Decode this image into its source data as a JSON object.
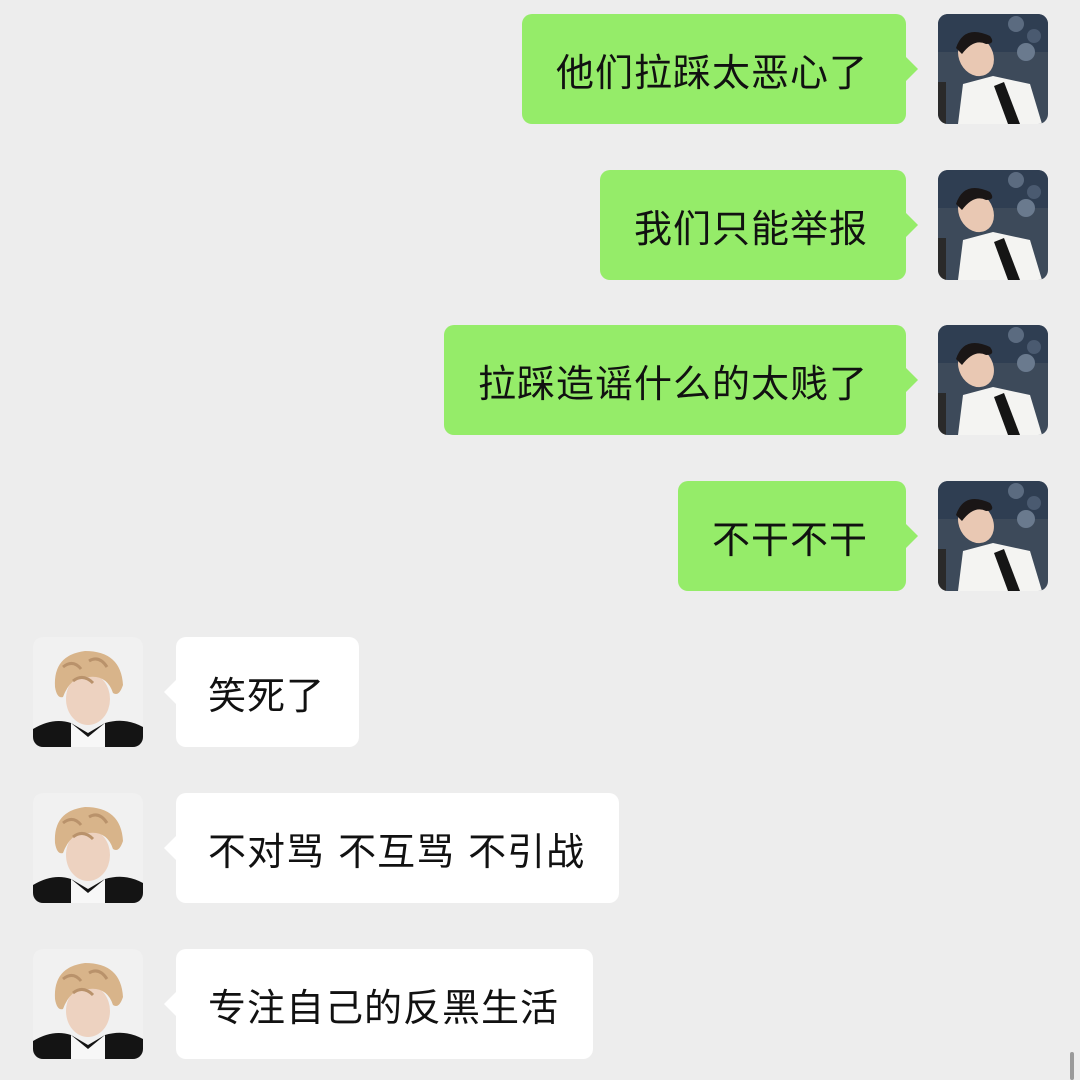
{
  "colors": {
    "background": "#ededed",
    "outgoing_bubble": "#95ec69",
    "incoming_bubble": "#ffffff",
    "text": "#111111"
  },
  "messages": [
    {
      "side": "outgoing",
      "avatar": "outgoing-user-avatar",
      "text": "他们拉踩太恶心了"
    },
    {
      "side": "outgoing",
      "avatar": "outgoing-user-avatar",
      "text": "我们只能举报"
    },
    {
      "side": "outgoing",
      "avatar": "outgoing-user-avatar",
      "text": "拉踩造谣什么的太贱了"
    },
    {
      "side": "outgoing",
      "avatar": "outgoing-user-avatar",
      "text": "不干不干"
    },
    {
      "side": "incoming",
      "avatar": "incoming-user-avatar",
      "text": "笑死了"
    },
    {
      "side": "incoming",
      "avatar": "incoming-user-avatar",
      "text": "不对骂 不互骂 不引战"
    },
    {
      "side": "incoming",
      "avatar": "incoming-user-avatar",
      "text": "专注自己的反黑生活"
    }
  ]
}
